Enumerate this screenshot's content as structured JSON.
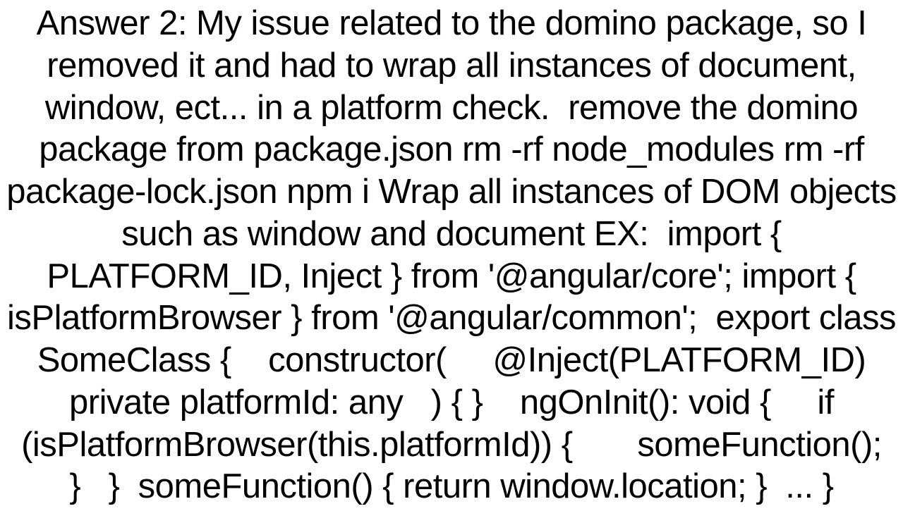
{
  "content": {
    "body": "Answer 2: My issue related to the domino package, so I removed it and had to wrap all instances of document, window, ect... in a platform check.  remove the domino package from package.json rm -rf node_modules rm -rf package-lock.json npm i Wrap all instances of DOM objects such as window and document EX:  import { PLATFORM_ID, Inject } from '@angular/core'; import { isPlatformBrowser } from '@angular/common';  export class SomeClass {    constructor(     @Inject(PLATFORM_ID) private platformId: any   ) { }    ngOnInit(): void {     if (isPlatformBrowser(this.platformId)) {       someFunction();     }   }  someFunction() { return window.location; }  ... }"
  }
}
